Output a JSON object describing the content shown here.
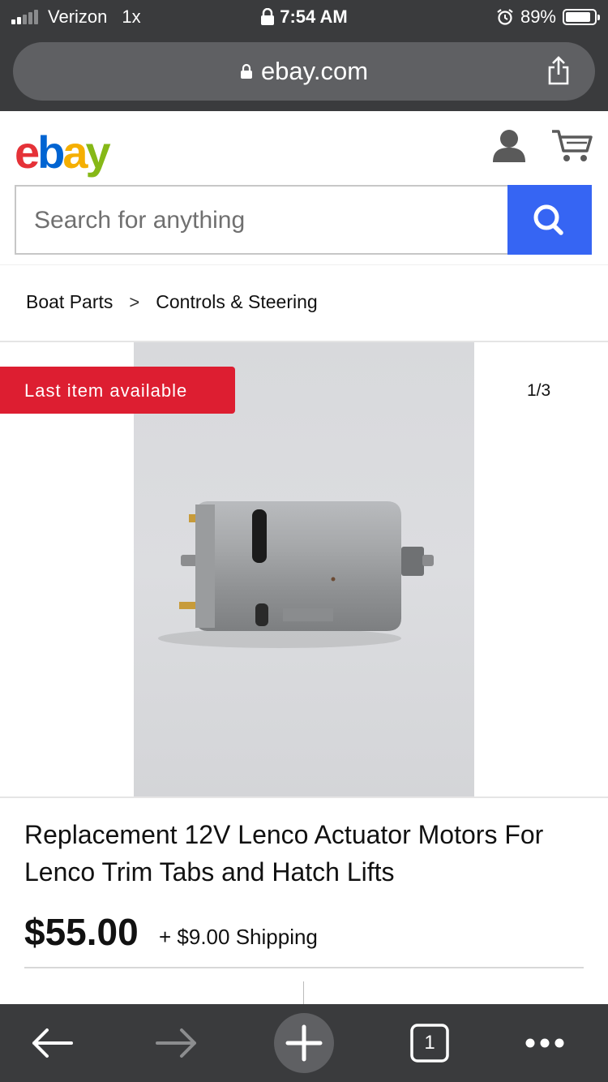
{
  "status_bar": {
    "carrier": "Verizon",
    "carrier_extra": "1x",
    "time": "7:54 AM",
    "battery": "89%"
  },
  "browser": {
    "url": "ebay.com",
    "tab_count": "1"
  },
  "header": {
    "logo_letters": [
      "e",
      "b",
      "a",
      "y"
    ],
    "logo_colors": [
      "#e53238",
      "#0064d2",
      "#f5af02",
      "#86b817"
    ]
  },
  "search": {
    "placeholder": "Search for anything",
    "button_color": "#3665f3"
  },
  "breadcrumb": {
    "items": [
      "Boat Parts",
      "Controls & Steering"
    ],
    "separator": ">"
  },
  "listing": {
    "badge": "Last item available",
    "badge_color": "#dd1e31",
    "image_counter": "1/3",
    "title": "Replacement 12V Lenco Actuator Motors For Lenco Trim Tabs and Hatch Lifts",
    "price": "$55.00",
    "shipping": "+ $9.00 Shipping"
  }
}
